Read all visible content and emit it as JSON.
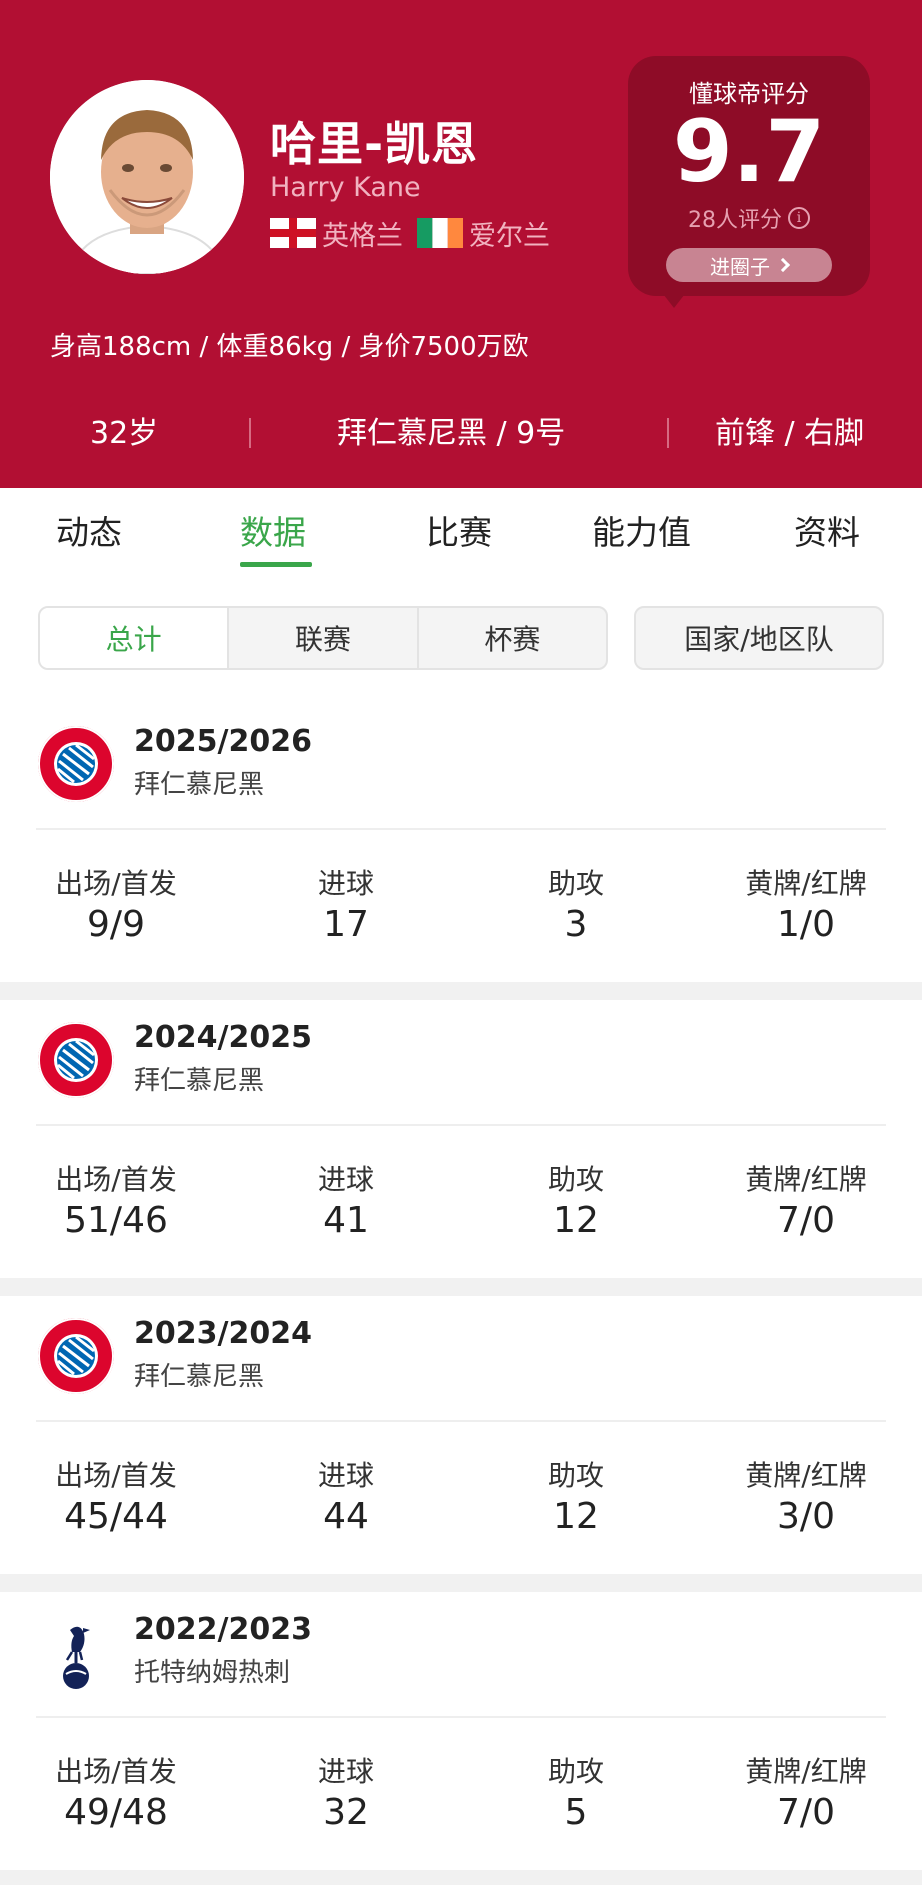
{
  "player": {
    "name_cn": "哈里-凯恩",
    "name_en": "Harry Kane",
    "nations": [
      {
        "name": "英格兰",
        "flag": "england-flag"
      },
      {
        "name": "爱尔兰",
        "flag": "ireland-flag"
      }
    ],
    "body_info": "身高188cm / 体重86kg / 身价7500万欧",
    "age": "32岁",
    "club_number": "拜仁慕尼黑 / 9号",
    "position_foot": "前锋 / 右脚"
  },
  "rating": {
    "label": "懂球帝评分",
    "score": "9.7",
    "count": "28人评分",
    "button": "进圈子"
  },
  "tabs": [
    {
      "label": "动态",
      "active": false
    },
    {
      "label": "数据",
      "active": true
    },
    {
      "label": "比赛",
      "active": false
    },
    {
      "label": "能力值",
      "active": false
    },
    {
      "label": "资料",
      "active": false
    }
  ],
  "filters": {
    "segments": [
      {
        "label": "总计",
        "active": true
      },
      {
        "label": "联赛",
        "active": false
      },
      {
        "label": "杯赛",
        "active": false
      }
    ],
    "country": "国家/地区队"
  },
  "stat_labels": [
    "出场/首发",
    "进球",
    "助攻",
    "黄牌/红牌"
  ],
  "seasons": [
    {
      "season": "2025/2026",
      "club": "拜仁慕尼黑",
      "crest": "bayern-crest-icon",
      "values": [
        "9/9",
        "17",
        "3",
        "1/0"
      ]
    },
    {
      "season": "2024/2025",
      "club": "拜仁慕尼黑",
      "crest": "bayern-crest-icon",
      "values": [
        "51/46",
        "41",
        "12",
        "7/0"
      ]
    },
    {
      "season": "2023/2024",
      "club": "拜仁慕尼黑",
      "crest": "bayern-crest-icon",
      "values": [
        "45/44",
        "44",
        "12",
        "3/0"
      ]
    },
    {
      "season": "2022/2023",
      "club": "托特纳姆热刺",
      "crest": "tottenham-crest-icon",
      "values": [
        "49/48",
        "32",
        "5",
        "7/0"
      ]
    }
  ],
  "colors": {
    "header_bg": "#b20f33",
    "accent_green": "#3aa64a",
    "rating_bg": "#8e0c27"
  }
}
